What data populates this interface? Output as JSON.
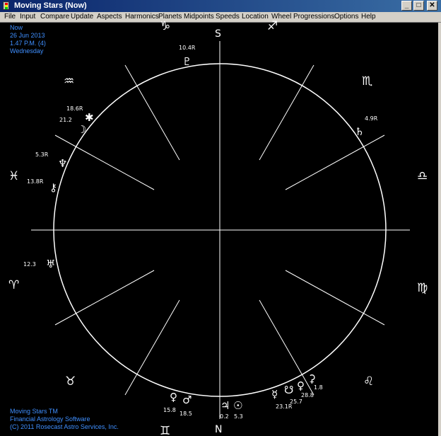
{
  "window": {
    "title": "Moving Stars (Now)",
    "minimize_glyph": "_",
    "maximize_glyph": "□",
    "close_glyph": "✕"
  },
  "menu": [
    "File",
    "Input",
    "Compare",
    "Update",
    "Aspects",
    "Harmonics",
    "Planets",
    "Midpoints",
    "Speeds",
    "Location",
    "Wheel",
    "Progressions",
    "Options",
    "Help"
  ],
  "chart_info": {
    "label": "Now",
    "date": "26 Jun 2013",
    "time": "1.47 P.M. (4)",
    "weekday": "Wednesday"
  },
  "footer": {
    "line1": "Moving Stars TM",
    "line2": "Financial Astrology Software",
    "line3": "(C) 2011 Rosecast Astro Services, Inc."
  },
  "compass": {
    "south": "S",
    "north": "N"
  },
  "zodiac_signs": [
    {
      "name": "capricorn",
      "glyph": "♑"
    },
    {
      "name": "sagittarius",
      "glyph": "♐"
    },
    {
      "name": "aquarius",
      "glyph": "♒"
    },
    {
      "name": "scorpio",
      "glyph": "♏"
    },
    {
      "name": "pisces",
      "glyph": "♓"
    },
    {
      "name": "libra",
      "glyph": "♎"
    },
    {
      "name": "aries",
      "glyph": "♈"
    },
    {
      "name": "virgo",
      "glyph": "♍"
    },
    {
      "name": "taurus",
      "glyph": "♉"
    },
    {
      "name": "leo",
      "glyph": "♌"
    },
    {
      "name": "gemini",
      "glyph": "♊"
    }
  ],
  "planets": [
    {
      "name": "pluto",
      "glyph": "♇",
      "degree": "10.4R"
    },
    {
      "name": "saturn",
      "glyph": "♄",
      "degree": "4.9R"
    },
    {
      "name": "moon",
      "glyph": "☽",
      "degree": "21.2"
    },
    {
      "name": "pallas",
      "glyph": "✱",
      "degree": "18.6R"
    },
    {
      "name": "neptune",
      "glyph": "♆",
      "degree": "5.3R"
    },
    {
      "name": "chiron",
      "glyph": "⚷",
      "degree": "13.8R"
    },
    {
      "name": "uranus",
      "glyph": "♅",
      "degree": "12.3"
    },
    {
      "name": "venus",
      "glyph": "♀",
      "degree": "25.7"
    },
    {
      "name": "mars",
      "glyph": "♂",
      "degree": "18.5"
    },
    {
      "name": "mercury",
      "glyph": "☿",
      "degree": "23.1R"
    },
    {
      "name": "node",
      "glyph": "☋",
      "degree": "28.8"
    },
    {
      "name": "ceres",
      "glyph": "⚳",
      "degree": "1.8"
    },
    {
      "name": "jupiter",
      "glyph": "♃",
      "degree": "0.2"
    },
    {
      "name": "sun",
      "glyph": "☉",
      "degree": "5.3"
    },
    {
      "name": "venus-left",
      "glyph": "♀",
      "degree": "15.8"
    }
  ],
  "colors": {
    "background": "#000000",
    "lines": "#ffffff",
    "info_text": "#3f8fff",
    "titlebar": "#0a246a"
  }
}
